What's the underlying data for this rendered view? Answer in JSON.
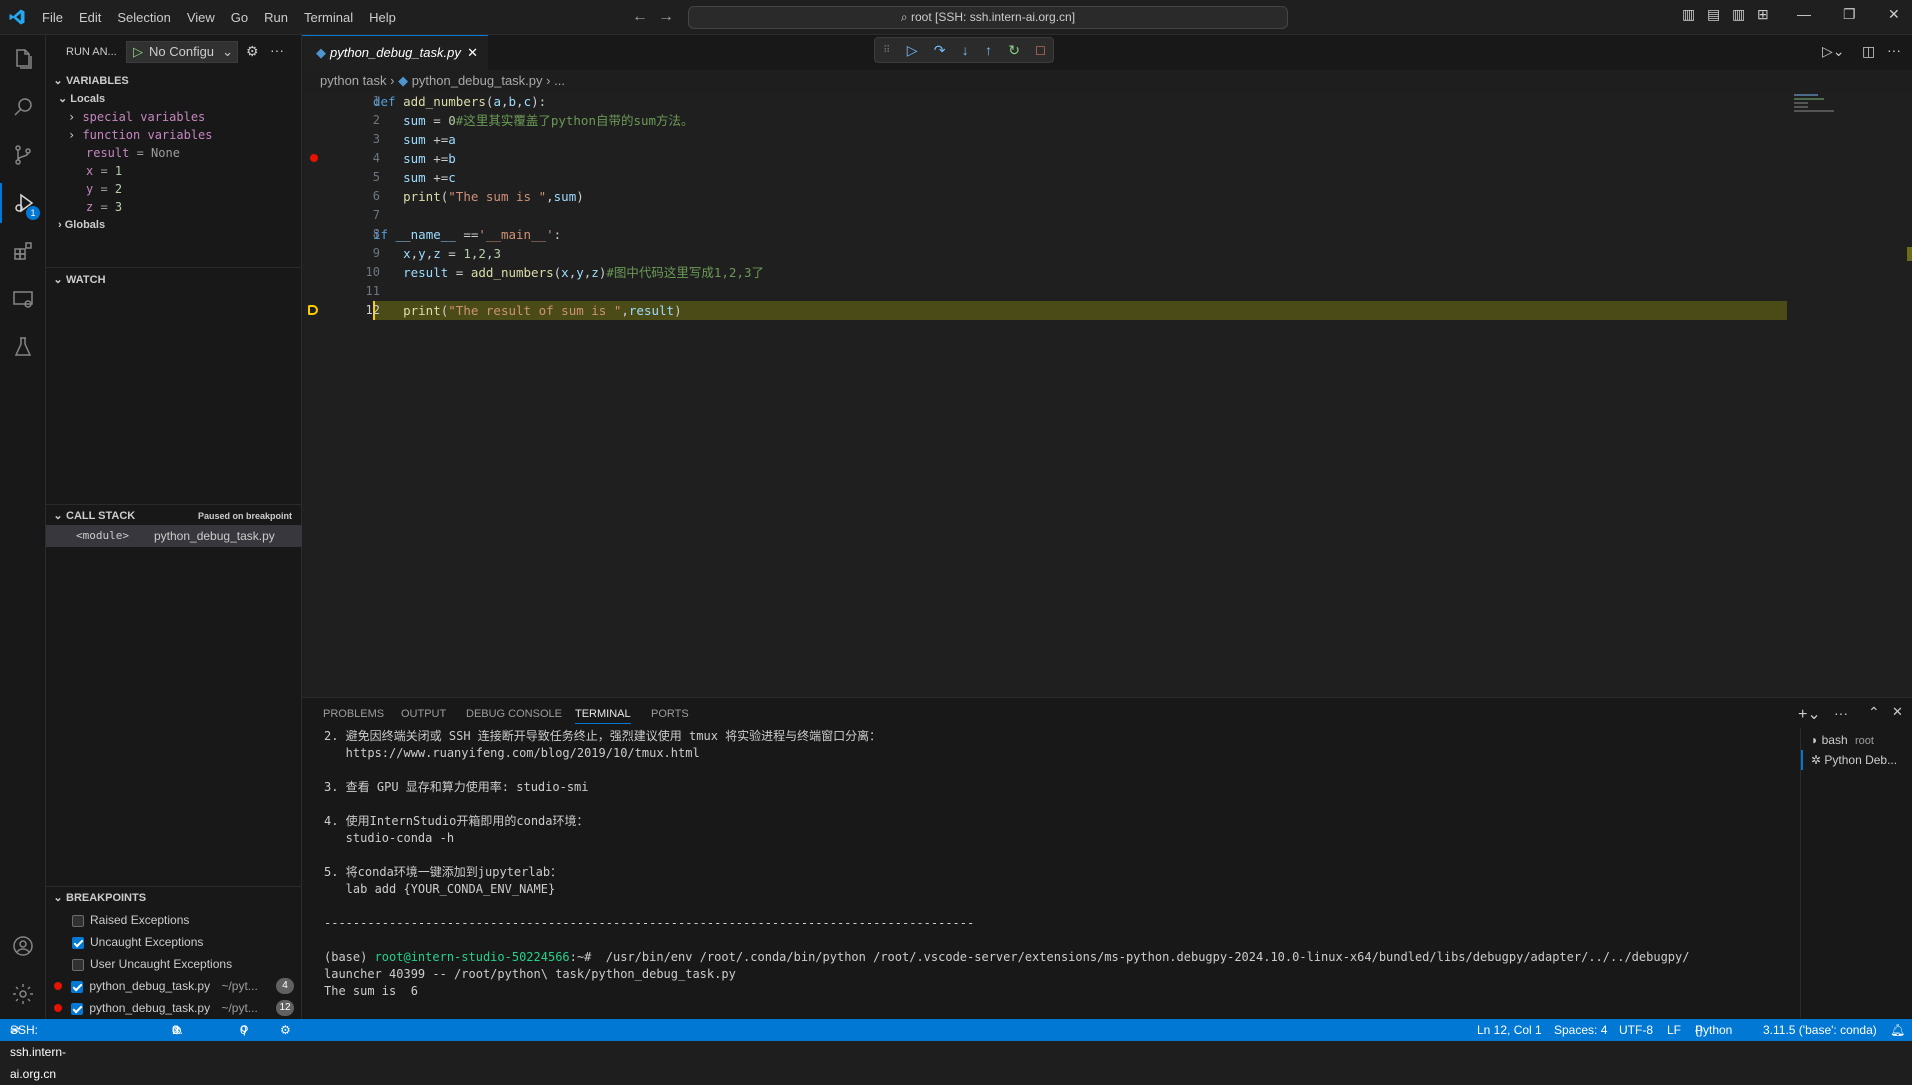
{
  "titlebar": {
    "menu": [
      "File",
      "Edit",
      "Selection",
      "View",
      "Go",
      "Run",
      "Terminal",
      "Help"
    ],
    "search": "root [SSH: ssh.intern-ai.org.cn]"
  },
  "sidebar": {
    "header_title": "RUN AN...",
    "config_select": "No Configu",
    "variables_title": "VARIABLES",
    "locals_label": "Locals",
    "locals": [
      {
        "label": "special variables",
        "expandable": true
      },
      {
        "label": "function variables",
        "expandable": true
      },
      {
        "name": "result",
        "eq": " = ",
        "value": "None"
      },
      {
        "name": "x",
        "eq": " = ",
        "value": "1"
      },
      {
        "name": "y",
        "eq": " = ",
        "value": "2"
      },
      {
        "name": "z",
        "eq": " = ",
        "value": "3"
      }
    ],
    "globals_label": "Globals",
    "watch_title": "WATCH",
    "callstack_title": "CALL STACK",
    "callstack_status": "Paused on breakpoint",
    "callstack_frame": {
      "name": "<module>",
      "file": "python_debug_task.py"
    },
    "breakpoints_title": "BREAKPOINTS",
    "breakpoints": [
      {
        "label": "Raised Exceptions",
        "checked": false
      },
      {
        "label": "Uncaught Exceptions",
        "checked": true
      },
      {
        "label": "User Uncaught Exceptions",
        "checked": false
      },
      {
        "label": "python_debug_task.py",
        "path": "~/pyt...",
        "line": "4",
        "checked": true
      },
      {
        "label": "python_debug_task.py",
        "path": "~/pyt...",
        "line": "12",
        "checked": true
      }
    ]
  },
  "editor": {
    "tab_label": "python_debug_task.py",
    "breadcrumb": [
      "python task",
      "python_debug_task.py",
      "..."
    ],
    "line_numbers": [
      "1",
      "2",
      "3",
      "4",
      "5",
      "6",
      "7",
      "8",
      "9",
      "10",
      "11",
      "12"
    ]
  },
  "panel": {
    "tabs": [
      "PROBLEMS",
      "OUTPUT",
      "DEBUG CONSOLE",
      "TERMINAL",
      "PORTS"
    ],
    "terminal_lines": [
      "2. 避免因终端关闭或 SSH 连接断开导致任务终止，强烈建议使用 tmux 将实验进程与终端窗口分离：",
      "   https://www.ruanyifeng.com/blog/2019/10/tmux.html",
      "",
      "3. 查看 GPU 显存和算力使用率: studio-smi",
      "",
      "4. 使用InternStudio开箱即用的conda环境：",
      "   studio-conda -h",
      "",
      "5. 将conda环境一键添加到jupyterlab：",
      "   lab add {YOUR_CONDA_ENV_NAME}",
      "",
      "------------------------------------------------------------------------------------------",
      "",
      "",
      "launcher 40399 -- /root/python\\ task/python_debug_task.py",
      "The sum is  6"
    ],
    "prompt_base": "(base) ",
    "prompt_user": "root@intern-studio-50224566",
    "prompt_path": ":~# ",
    "prompt_cmd": " /usr/bin/env /root/.conda/bin/python /root/.vscode-server/extensions/ms-python.debugpy-2024.10.0-linux-x64/bundled/libs/debugpy/adapter/../../debugpy/",
    "terminals": [
      {
        "name": "bash",
        "detail": "root"
      },
      {
        "name": "Python Deb...",
        "detail": ""
      }
    ]
  },
  "statusbar": {
    "remote": "SSH: ssh.intern-ai.org.cn",
    "errors": "0",
    "warnings": "0",
    "ports": "0",
    "position": "Ln 12, Col 1",
    "spaces": "Spaces: 4",
    "encoding": "UTF-8",
    "eol": "LF",
    "language": "Python",
    "interpreter": "3.11.5 ('base': conda)"
  },
  "colors": {
    "accent": "#0078d4",
    "breakpoint": "#e51400",
    "current_line": "#4b4b18"
  }
}
